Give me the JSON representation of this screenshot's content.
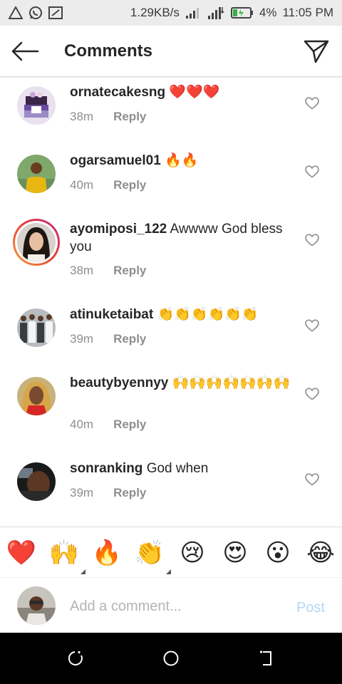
{
  "status_bar": {
    "net_speed": "1.29KB/s",
    "battery": "4%",
    "time": "11:05 PM"
  },
  "header": {
    "title": "Comments"
  },
  "comments": [
    {
      "username": "ornatecakesng",
      "text": "❤️❤️❤️",
      "time": "38m",
      "reply": "Reply"
    },
    {
      "username": "ogarsamuel01",
      "text": "🔥🔥",
      "time": "40m",
      "reply": "Reply"
    },
    {
      "username": "ayomiposi_122",
      "text": "Awwww God bless you",
      "time": "38m",
      "reply": "Reply"
    },
    {
      "username": "atinuketaibat",
      "text": "👏👏👏👏👏👏",
      "time": "39m",
      "reply": "Reply"
    },
    {
      "username": "beautybyennyy",
      "text": "🙌🙌🙌🙌🙌🙌🙌",
      "time": "40m",
      "reply": "Reply"
    },
    {
      "username": "sonranking",
      "text": "God when",
      "time": "39m",
      "reply": "Reply"
    }
  ],
  "emoji_bar": [
    "❤️",
    "🙌",
    "🔥",
    "👏",
    "😢",
    "😍",
    "😮",
    "😂"
  ],
  "composer": {
    "placeholder": "Add a comment...",
    "post_label": "Post"
  },
  "colors": {
    "text": "#262626",
    "secondary": "#8e8e8e",
    "post_disabled": "#b3d7f7",
    "story_ring": "#e8423a"
  }
}
